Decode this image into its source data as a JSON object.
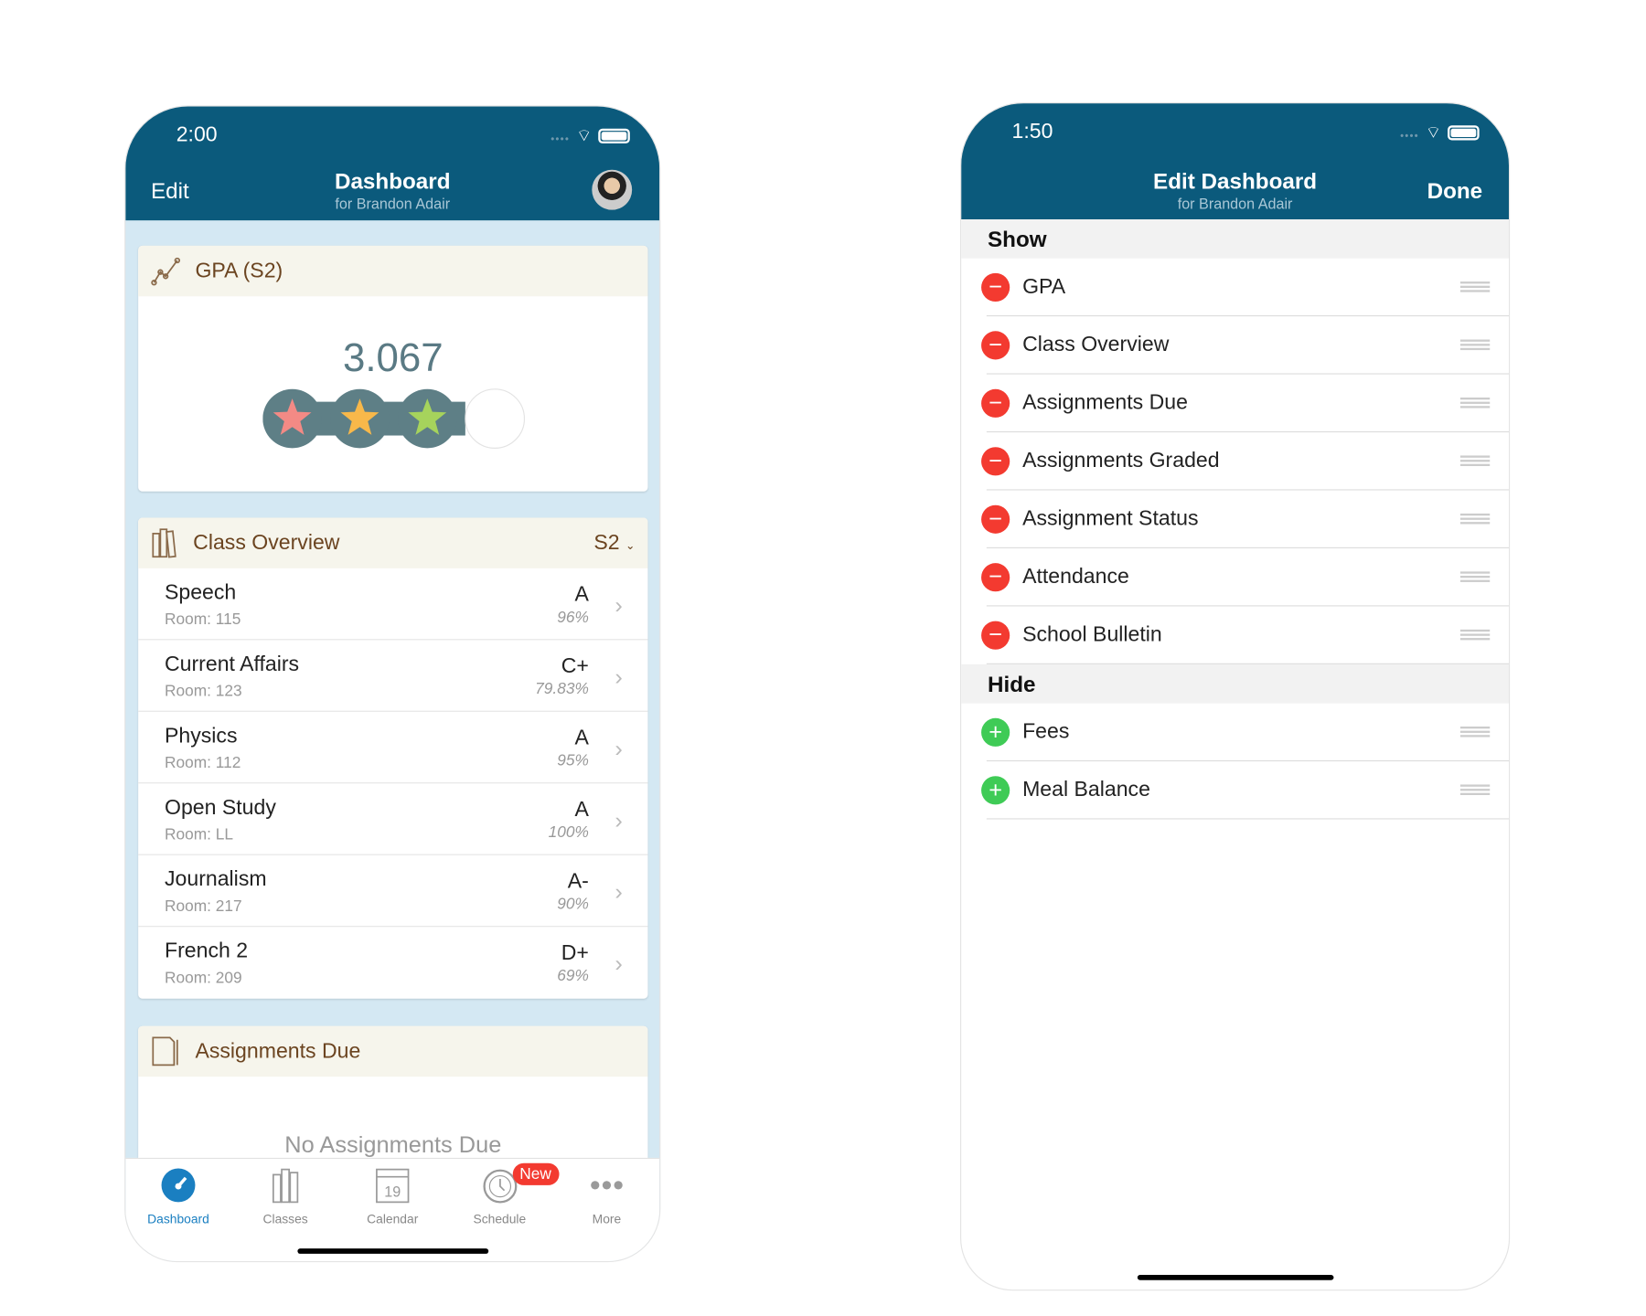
{
  "left": {
    "status": {
      "time": "2:00"
    },
    "header": {
      "edit": "Edit",
      "title": "Dashboard",
      "subtitle": "for Brandon Adair"
    },
    "gpa": {
      "title": "GPA (S2)",
      "value": "3.067",
      "stars_filled": 3,
      "stars_total": 4,
      "star_colors": [
        "#f38a85",
        "#f8b84a",
        "#a6d35c"
      ]
    },
    "class_overview": {
      "title": "Class Overview",
      "term": "S2",
      "rows": [
        {
          "name": "Speech",
          "room": "Room: 115",
          "grade": "A",
          "percent": "96%"
        },
        {
          "name": "Current Affairs",
          "room": "Room: 123",
          "grade": "C+",
          "percent": "79.83%"
        },
        {
          "name": "Physics",
          "room": "Room: 112",
          "grade": "A",
          "percent": "95%"
        },
        {
          "name": "Open Study",
          "room": "Room: LL",
          "grade": "A",
          "percent": "100%"
        },
        {
          "name": "Journalism",
          "room": "Room: 217",
          "grade": "A-",
          "percent": "90%"
        },
        {
          "name": "French 2",
          "room": "Room: 209",
          "grade": "D+",
          "percent": "69%"
        }
      ]
    },
    "assignments_due": {
      "title": "Assignments Due",
      "empty": "No Assignments Due"
    },
    "tabs": [
      {
        "label": "Dashboard",
        "icon": "gauge-icon",
        "active": true
      },
      {
        "label": "Classes",
        "icon": "books-icon"
      },
      {
        "label": "Calendar",
        "icon": "calendar-icon",
        "day": "19"
      },
      {
        "label": "Schedule",
        "icon": "clock-icon",
        "badge": "New"
      },
      {
        "label": "More",
        "icon": "more-icon"
      }
    ]
  },
  "right": {
    "status": {
      "time": "1:50"
    },
    "header": {
      "title": "Edit Dashboard",
      "subtitle": "for Brandon Adair",
      "done": "Done"
    },
    "show_label": "Show",
    "show": [
      "GPA",
      "Class Overview",
      "Assignments Due",
      "Assignments Graded",
      "Assignment Status",
      "Attendance",
      "School Bulletin"
    ],
    "hide_label": "Hide",
    "hide": [
      "Fees",
      "Meal Balance"
    ]
  },
  "colors": {
    "header": "#0b5a7c",
    "remove": "#f33a30",
    "add": "#3fcb56",
    "accent": "#1a7fc1"
  }
}
